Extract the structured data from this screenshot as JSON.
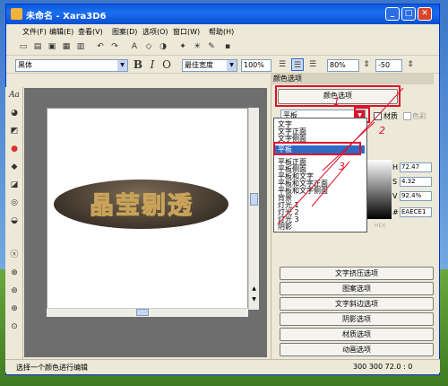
{
  "window": {
    "title": "未命名 - Xara3D6"
  },
  "menu": [
    "文件(F)",
    "编辑(E)",
    "查看(V)",
    "图案(D)",
    "选项(O)",
    "窗口(W)",
    "帮助(H)"
  ],
  "toolbar2": {
    "font": "黑体",
    "bold": "B",
    "italic": "I",
    "outline": "O",
    "width_mode": "最佳宽度",
    "zoom": "100%",
    "spacing": "80%",
    "offset": "-50"
  },
  "canvas": {
    "text": "晶莹剔透"
  },
  "panel": {
    "title": "颜色选项",
    "header_button": "颜色选项",
    "combo_value": "平板",
    "material_label": "材质",
    "color_label": "色彩",
    "dropdown_items": [
      "文字",
      "文字正面",
      "文字侧面",
      "平板",
      "平板正面",
      "平板侧面",
      "平板和文字",
      "平板和文字正面",
      "平板和文字侧面",
      "背景",
      "灯光 1",
      "灯光 2",
      "灯光 3",
      "阴影"
    ],
    "dropdown_selected_index": 3,
    "hsv": [
      {
        "label": "H",
        "value": "72.47"
      },
      {
        "label": "S",
        "value": "4.32"
      },
      {
        "label": "V",
        "value": "92.4%"
      },
      {
        "label": "#",
        "value": "EAECE1"
      }
    ],
    "hex_label": "HEX",
    "buttons": [
      "文字挤压选项",
      "图案选项",
      "文字斜边选项",
      "阴影选项",
      "材质选项",
      "动画选项"
    ]
  },
  "annotations": [
    "1",
    "2",
    "3"
  ],
  "status": {
    "text": "选择一个颜色进行编辑",
    "coords": "300 300 72.0 : 0"
  },
  "colors": {
    "highlight": "#e0102a",
    "selection": "#316ac5",
    "titlebar": "#0a5bdb"
  }
}
